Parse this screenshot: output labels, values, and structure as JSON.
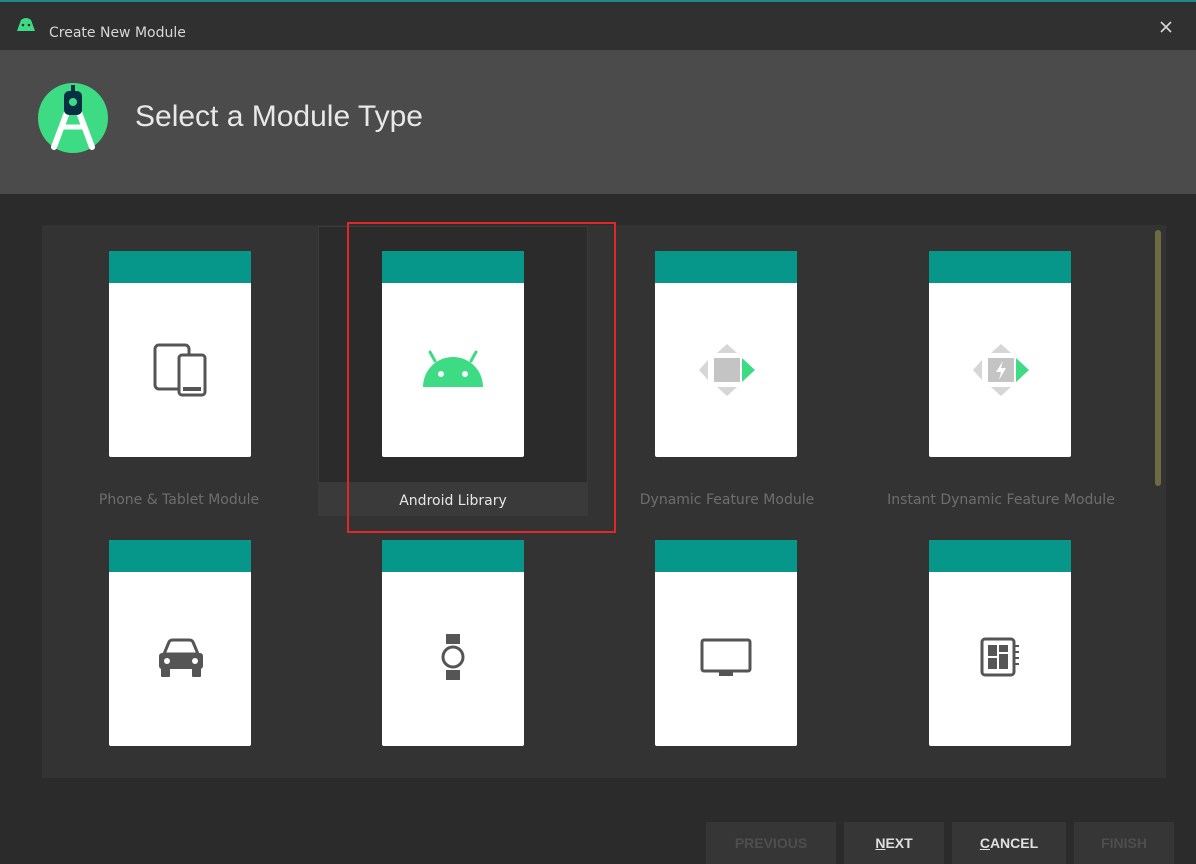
{
  "window": {
    "title": "Create New Module",
    "app_icon": "android-studio-icon",
    "close_icon": "close-icon"
  },
  "header": {
    "title": "Select a Module Type",
    "logo": "android-studio-logo-icon"
  },
  "modules": [
    {
      "label": "Phone & Tablet Module",
      "icon": "phone-tablet-icon",
      "selected": false
    },
    {
      "label": "Android Library",
      "icon": "android-head-icon",
      "selected": true
    },
    {
      "label": "Dynamic Feature Module",
      "icon": "dynamic-feature-icon",
      "selected": false
    },
    {
      "label": "Instant Dynamic Feature Module",
      "icon": "instant-dynamic-feature-icon",
      "selected": false
    },
    {
      "label": "",
      "icon": "car-icon",
      "selected": false
    },
    {
      "label": "",
      "icon": "watch-icon",
      "selected": false
    },
    {
      "label": "",
      "icon": "tv-icon",
      "selected": false
    },
    {
      "label": "",
      "icon": "things-board-icon",
      "selected": false
    }
  ],
  "buttons": {
    "previous": {
      "label": "PREVIOUS",
      "enabled": false
    },
    "next": {
      "mnemonic": "N",
      "rest": "EXT",
      "enabled": true
    },
    "cancel": {
      "mnemonic": "C",
      "rest": "ANCEL",
      "enabled": true
    },
    "finish": {
      "label": "FINISH",
      "enabled": false
    }
  },
  "colors": {
    "card_band": "#07968a",
    "android_green": "#3ddc84",
    "selection_outline": "#e02828"
  }
}
